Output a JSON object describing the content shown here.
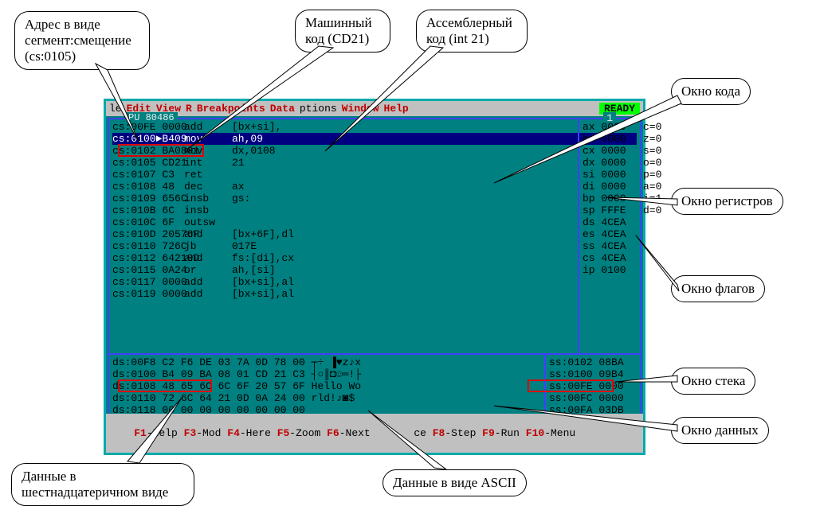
{
  "menu": {
    "file": "le",
    "edit": "Edit",
    "view": "View",
    "run": "R",
    "bp": "Breakpoints",
    "data": "Data",
    "opts": "ptions",
    "win": "Window",
    "help": "Help",
    "ready": "READY"
  },
  "cpu_title": "PU 80486",
  "code_rows": [
    {
      "addr": "cs:00FE 0000",
      "mn": "add",
      "arg": "[bx+si],"
    },
    {
      "addr": "cs:0100►B409",
      "mn": "mov",
      "arg": "ah,09",
      "sel": true
    },
    {
      "addr": "cs:0102 BA0801",
      "mn": "mov",
      "arg": "dx,0108"
    },
    {
      "addr": "cs:0105 CD21",
      "mn": "int",
      "arg": "21"
    },
    {
      "addr": "cs:0107 C3",
      "mn": "ret",
      "arg": ""
    },
    {
      "addr": "cs:0108 48",
      "mn": "dec",
      "arg": "ax"
    },
    {
      "addr": "cs:0109 656C",
      "mn": "insb",
      "arg": "gs:"
    },
    {
      "addr": "cs:010B 6C",
      "mn": "insb",
      "arg": ""
    },
    {
      "addr": "cs:010C 6F",
      "mn": "outsw",
      "arg": ""
    },
    {
      "addr": "cs:010D 20576F",
      "mn": "and",
      "arg": "[bx+6F],dl"
    },
    {
      "addr": "cs:0110 726C",
      "mn": "jb",
      "arg": "017E"
    },
    {
      "addr": "cs:0112 64210D",
      "mn": "and",
      "arg": "fs:[di],cx"
    },
    {
      "addr": "cs:0115 0A24",
      "mn": "or",
      "arg": "ah,[si]"
    },
    {
      "addr": "cs:0117 0000",
      "mn": "add",
      "arg": "[bx+si],al"
    },
    {
      "addr": "cs:0119 0000",
      "mn": "add",
      "arg": "[bx+si],al"
    }
  ],
  "registers": [
    "ax 0000",
    "bx  0000",
    "cx 0000",
    "dx 0000",
    "si 0000",
    "di 0000",
    "bp 0000",
    "sp FFFE",
    "ds 4CEA",
    "es 4CEA",
    "ss 4CEA",
    "cs 4CEA",
    "ip 0100"
  ],
  "flags": [
    "c=0",
    "z=0",
    "s=0",
    "o=0",
    "p=0",
    "a=0",
    "i=1",
    "d=0"
  ],
  "dump": [
    "ds:00F8 C2 F6  DE 03 7A 0D 78 00 ┬÷ ▐♥z♪x ",
    "ds:0100 B4 09  BA 08 01 CD 21 C3 ┤○║◘☺═!├",
    "ds:0108 48 65  6C 6C 6F 20 57 6F Hello Wo",
    "ds:0110 72 6C 64 21 0D 0A 24 00 rld!♪◙$ ",
    "ds:0118 00 00  00 00 00 00 00 00"
  ],
  "stack": [
    "ss:0102 08BA",
    "ss:0100 09B4",
    "ss:00FE 0000",
    "ss:00FC 0000",
    "ss:00FA 03DB"
  ],
  "status": {
    "f1": "F1",
    "h": "-Help ",
    "f3": "F3",
    "m": "-Mod ",
    "f4": "F4",
    "he": "-Here ",
    "f5": "F5",
    "z": "-Zoom ",
    "f6": "F6",
    "n": "-Next ",
    "sp": "      ce ",
    "f8": "F8",
    "s": "-Step ",
    "f9": "F9",
    "r": "-Run ",
    "f10": "F10",
    "mn": "-Menu"
  },
  "callouts": {
    "addr": "Адрес в виде\nсегмент:смещение\n(cs:0105)",
    "mc": "Машинный\nкод (CD21)",
    "ac": "Ассемблерный\nкод (int 21)",
    "codewin": "Окно кода",
    "regwin": "Окно регистров",
    "flagwin": "Окно флагов",
    "stackwin": "Окно стека",
    "datawin": "Окно данных",
    "hex": "Данные в\nшестнадцатеричном виде",
    "ascii": "Данные в виде ASCII"
  }
}
